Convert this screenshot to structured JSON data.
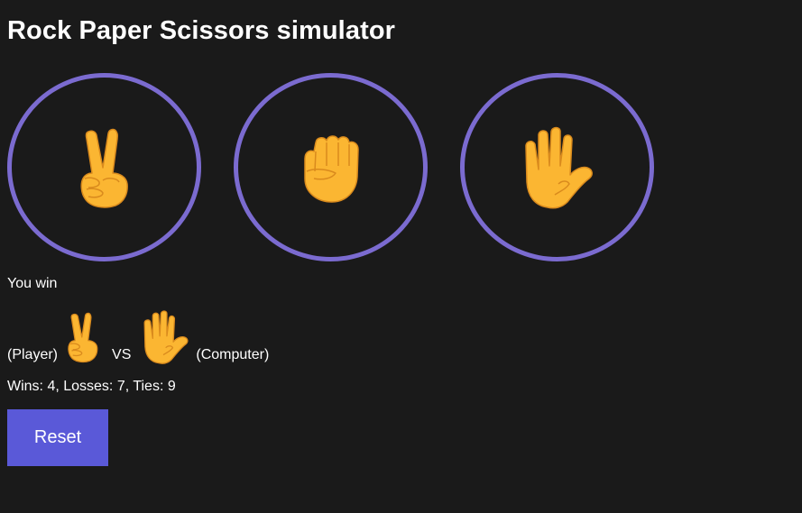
{
  "page": {
    "title": "Rock Paper Scissors simulator"
  },
  "choices": [
    {
      "name": "scissors",
      "icon": "victory-hand-icon"
    },
    {
      "name": "rock",
      "icon": "raised-fist-icon"
    },
    {
      "name": "paper",
      "icon": "raised-hand-icon"
    }
  ],
  "result": {
    "message": "You win"
  },
  "matchup": {
    "player_label": "(Player)",
    "player_choice_icon": "victory-hand-icon",
    "vs_label": "VS",
    "computer_choice_icon": "raised-hand-icon",
    "computer_label": "(Computer)"
  },
  "score": {
    "text": "Wins: 4, Losses: 7, Ties: 9"
  },
  "reset": {
    "label": "Reset"
  },
  "colors": {
    "background": "#1a1a1a",
    "circle_border": "#7b6bd0",
    "button": "#5a59d8",
    "emoji_fill": "#fbb632",
    "emoji_line": "#d98a1d"
  }
}
